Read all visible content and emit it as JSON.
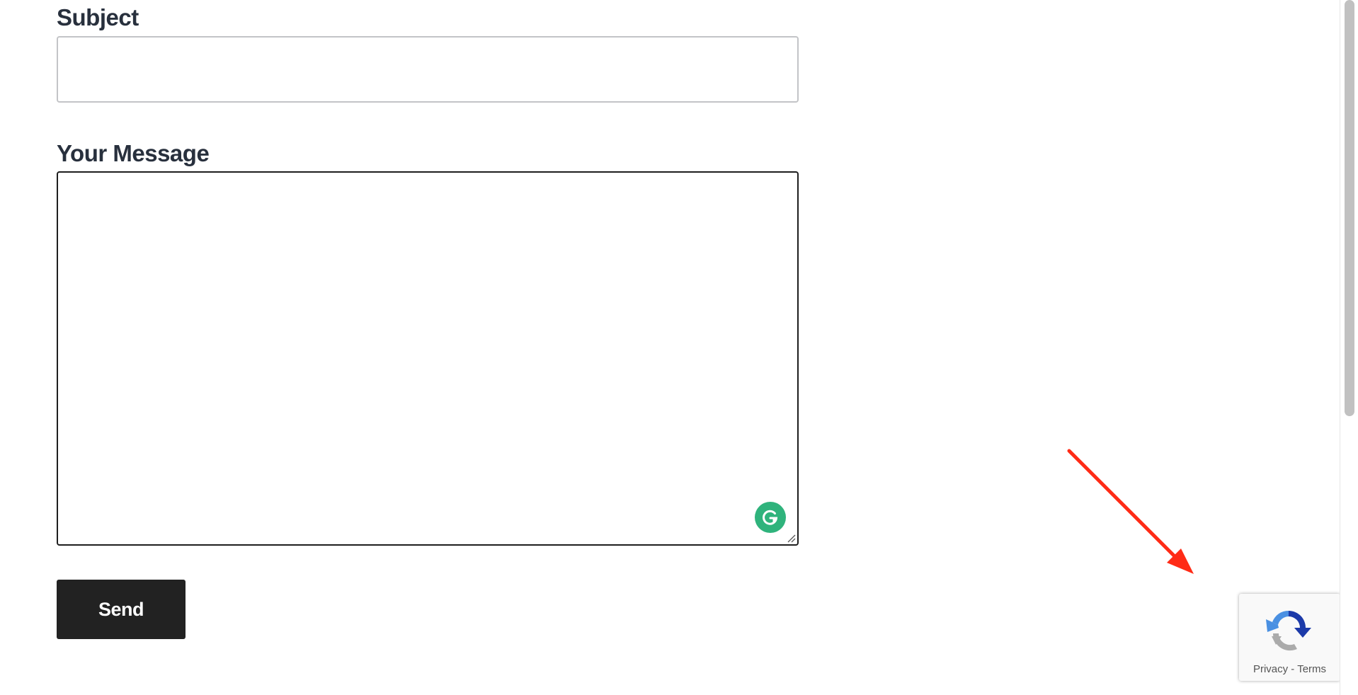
{
  "form": {
    "subject_label": "Subject",
    "subject_value": "",
    "message_label": "Your Message",
    "message_value": "",
    "send_label": "Send"
  },
  "grammarly": {
    "icon": "grammarly-icon",
    "color": "#2fb37c"
  },
  "recaptcha": {
    "icon": "recaptcha-logo-icon",
    "privacy_label": "Privacy",
    "separator": " - ",
    "terms_label": "Terms"
  },
  "annotation": {
    "icon": "red-arrow-icon",
    "color": "#ff2b16"
  },
  "colors": {
    "label_text": "#28303d",
    "button_bg": "#222222",
    "button_text": "#ffffff"
  }
}
